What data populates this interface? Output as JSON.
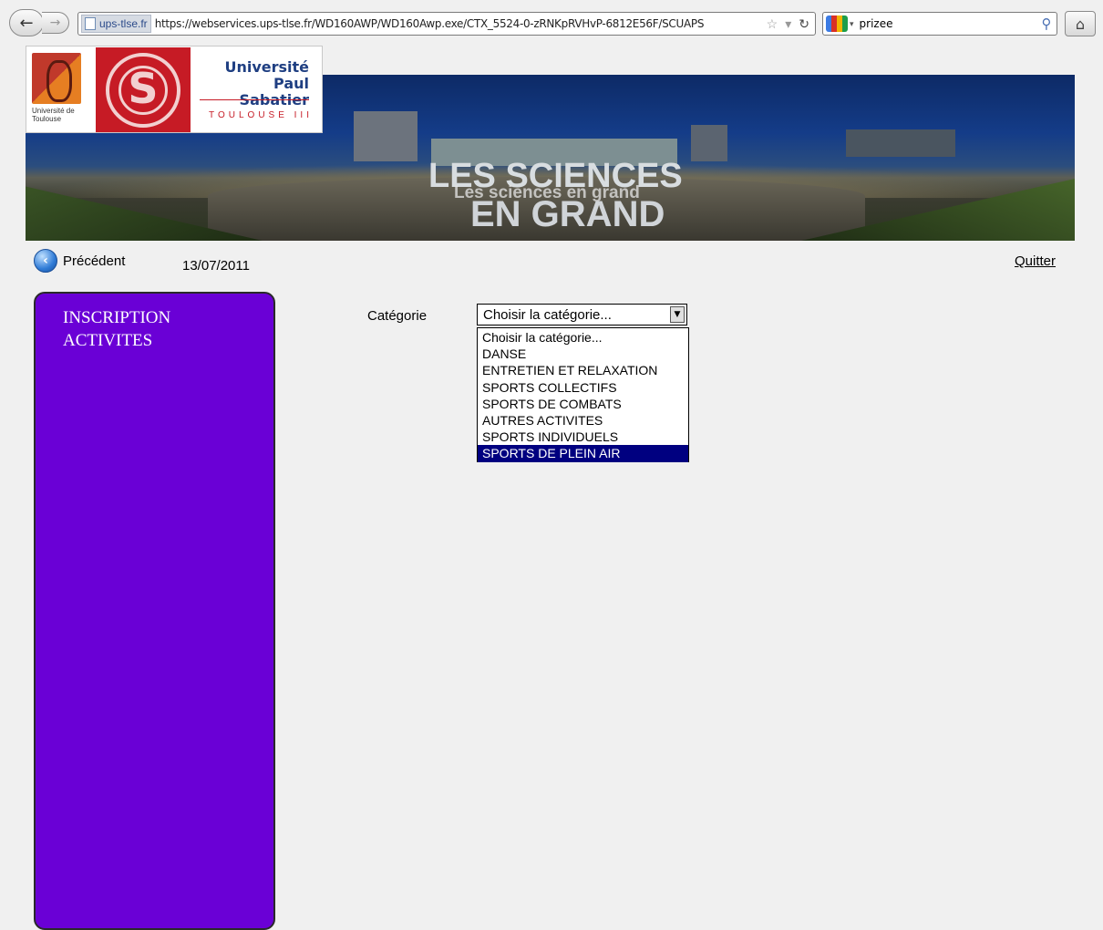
{
  "browser": {
    "site_identity": "ups-tlse.fr",
    "url": "https://webservices.ups-tlse.fr/WD160AWP/WD160Awp.exe/CTX_5524-0-zRNKpRVHvP-6812E56F/SCUAPS",
    "search_value": "prizee",
    "icons": [
      "back-icon",
      "forward-icon",
      "page-icon",
      "star-icon",
      "dropdown-icon",
      "reload-icon",
      "search-engine-icon",
      "search-icon",
      "home-icon"
    ]
  },
  "header": {
    "ut_label": "Université de Toulouse",
    "university_name_line1": "Université",
    "university_name_line2": "Paul Sabatier",
    "university_city": "TOULOUSE III",
    "banner_slogan_top": "LES SCIENCES",
    "banner_slogan_middle": "Les sciences en grand",
    "banner_slogan_bottom": "EN GRAND"
  },
  "nav": {
    "previous_label": "Précédent",
    "date": "13/07/2011",
    "quit_label": "Quitter"
  },
  "sidebar": {
    "title_line1": "INSCRIPTION",
    "title_line2": "ACTIVITES",
    "color": "#6a00d6"
  },
  "form": {
    "category_label": "Catégorie",
    "select_value": "Choisir la catégorie...",
    "options": [
      "Choisir la catégorie...",
      "DANSE",
      "ENTRETIEN ET RELAXATION",
      "SPORTS COLLECTIFS",
      "SPORTS DE COMBATS",
      "AUTRES ACTIVITES",
      "SPORTS INDIVIDUELS",
      "SPORTS DE PLEIN AIR"
    ],
    "highlighted_option": "SPORTS DE PLEIN AIR",
    "highlight_color": "#000080"
  }
}
